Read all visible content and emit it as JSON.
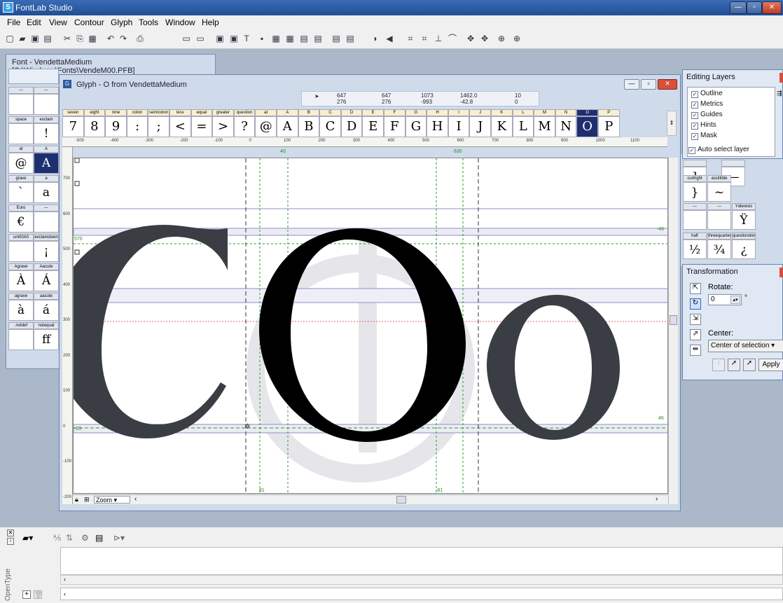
{
  "app": {
    "title": "FontLab Studio",
    "logo": "S",
    "min": "—",
    "max": "▫",
    "close": "✕"
  },
  "menu": [
    "File",
    "Edit",
    "View",
    "Contour",
    "Glyph",
    "Tools",
    "Window",
    "Help"
  ],
  "font_window": {
    "title": "Font - VendettaMedium [C:\\Windows\\Fonts\\VendeM00.PFB]",
    "cells": [
      {
        "name": "---",
        "glyph": ""
      },
      {
        "name": "---",
        "glyph": ""
      },
      {
        "name": "space",
        "glyph": ""
      },
      {
        "name": "exclam",
        "glyph": "!"
      },
      {
        "name": "at",
        "glyph": "@"
      },
      {
        "name": "A",
        "glyph": "A"
      },
      {
        "name": "grave",
        "glyph": "`"
      },
      {
        "name": "a",
        "glyph": "a"
      },
      {
        "name": "Euro",
        "glyph": "€"
      },
      {
        "name": "---",
        "glyph": ""
      },
      {
        "name": "uni00A0",
        "glyph": ""
      },
      {
        "name": "exclamdown",
        "glyph": "¡"
      },
      {
        "name": "Agrave",
        "glyph": "À"
      },
      {
        "name": "Aacute",
        "glyph": "Á"
      },
      {
        "name": "agrave",
        "glyph": "à"
      },
      {
        "name": "aacute",
        "glyph": "á"
      },
      {
        "name": ".notdef",
        "glyph": ""
      },
      {
        "name": "notequal",
        "glyph": "ff"
      }
    ],
    "right_cells": [
      {
        "name": "",
        "glyph": "]"
      },
      {
        "name": "",
        "glyph": "—"
      },
      {
        "name": "curlright",
        "glyph": "}"
      },
      {
        "name": "asciitilde",
        "glyph": "~"
      },
      {
        "name": "---",
        "glyph": ""
      },
      {
        "name": "---",
        "glyph": ""
      },
      {
        "name": "Ydieresis",
        "glyph": "Ÿ"
      },
      {
        "name": "half",
        "glyph": "½"
      },
      {
        "name": "threequarters",
        "glyph": "¾"
      },
      {
        "name": "questiondown",
        "glyph": "¿"
      }
    ]
  },
  "glyph_window": {
    "title": "Glyph - O from VendettaMedium",
    "info": {
      "x1": "647",
      "y1": "276",
      "x2": "647",
      "y2": "276",
      "w": "1073",
      "h": "-993",
      "len": "1462.0",
      "ang": "-42.8",
      "n1": "10",
      "n2": "0"
    },
    "strip": [
      {
        "name": "seven",
        "glyph": "7"
      },
      {
        "name": "eight",
        "glyph": "8"
      },
      {
        "name": "nine",
        "glyph": "9"
      },
      {
        "name": "colon",
        "glyph": ":"
      },
      {
        "name": "semicolon",
        "glyph": ";"
      },
      {
        "name": "less",
        "glyph": "<"
      },
      {
        "name": "equal",
        "glyph": "="
      },
      {
        "name": "greater",
        "glyph": ">"
      },
      {
        "name": "question",
        "glyph": "?"
      },
      {
        "name": "at",
        "glyph": "@"
      },
      {
        "name": "A",
        "glyph": "A"
      },
      {
        "name": "B",
        "glyph": "B"
      },
      {
        "name": "C",
        "glyph": "C"
      },
      {
        "name": "D",
        "glyph": "D"
      },
      {
        "name": "E",
        "glyph": "E"
      },
      {
        "name": "F",
        "glyph": "F"
      },
      {
        "name": "G",
        "glyph": "G"
      },
      {
        "name": "H",
        "glyph": "H"
      },
      {
        "name": "I",
        "glyph": "I"
      },
      {
        "name": "J",
        "glyph": "J"
      },
      {
        "name": "K",
        "glyph": "K"
      },
      {
        "name": "L",
        "glyph": "L"
      },
      {
        "name": "M",
        "glyph": "M"
      },
      {
        "name": "N",
        "glyph": "N"
      },
      {
        "name": "O",
        "glyph": "O"
      },
      {
        "name": "P",
        "glyph": "P"
      }
    ],
    "hruler": [
      "-500",
      "-400",
      "-300",
      "-200",
      "-100",
      "0",
      "100",
      "200",
      "300",
      "400",
      "500",
      "600",
      "700",
      "800",
      "900",
      "1000",
      "1100"
    ],
    "vruler": [
      "700",
      "600",
      "500",
      "400",
      "300",
      "200",
      "100",
      "0",
      "-100",
      "-200"
    ],
    "guides": {
      "ascender": "570",
      "descender": "-20",
      "right46a": "-46",
      "right46b": "46",
      "top40": "40",
      "top630": "630",
      "bot81a": "81",
      "bot81b": "-81"
    },
    "zoom_label": "Zoom",
    "preview": "COo"
  },
  "editing_layers": {
    "title": "Editing Layers",
    "layers": [
      {
        "label": "Outline",
        "checked": true
      },
      {
        "label": "Metrics",
        "checked": true
      },
      {
        "label": "Guides",
        "checked": true
      },
      {
        "label": "Hints",
        "checked": true
      },
      {
        "label": "Mask",
        "checked": true
      }
    ],
    "auto": "Auto select layer"
  },
  "transformation": {
    "title": "Transformation",
    "rotate_label": "Rotate:",
    "rotate_value": "0",
    "degree": "°",
    "center_label": "Center:",
    "center_value": "Center of selection",
    "apply": "Apply"
  },
  "bottom_panel": {
    "label": "OpenType",
    "plus": "+"
  }
}
